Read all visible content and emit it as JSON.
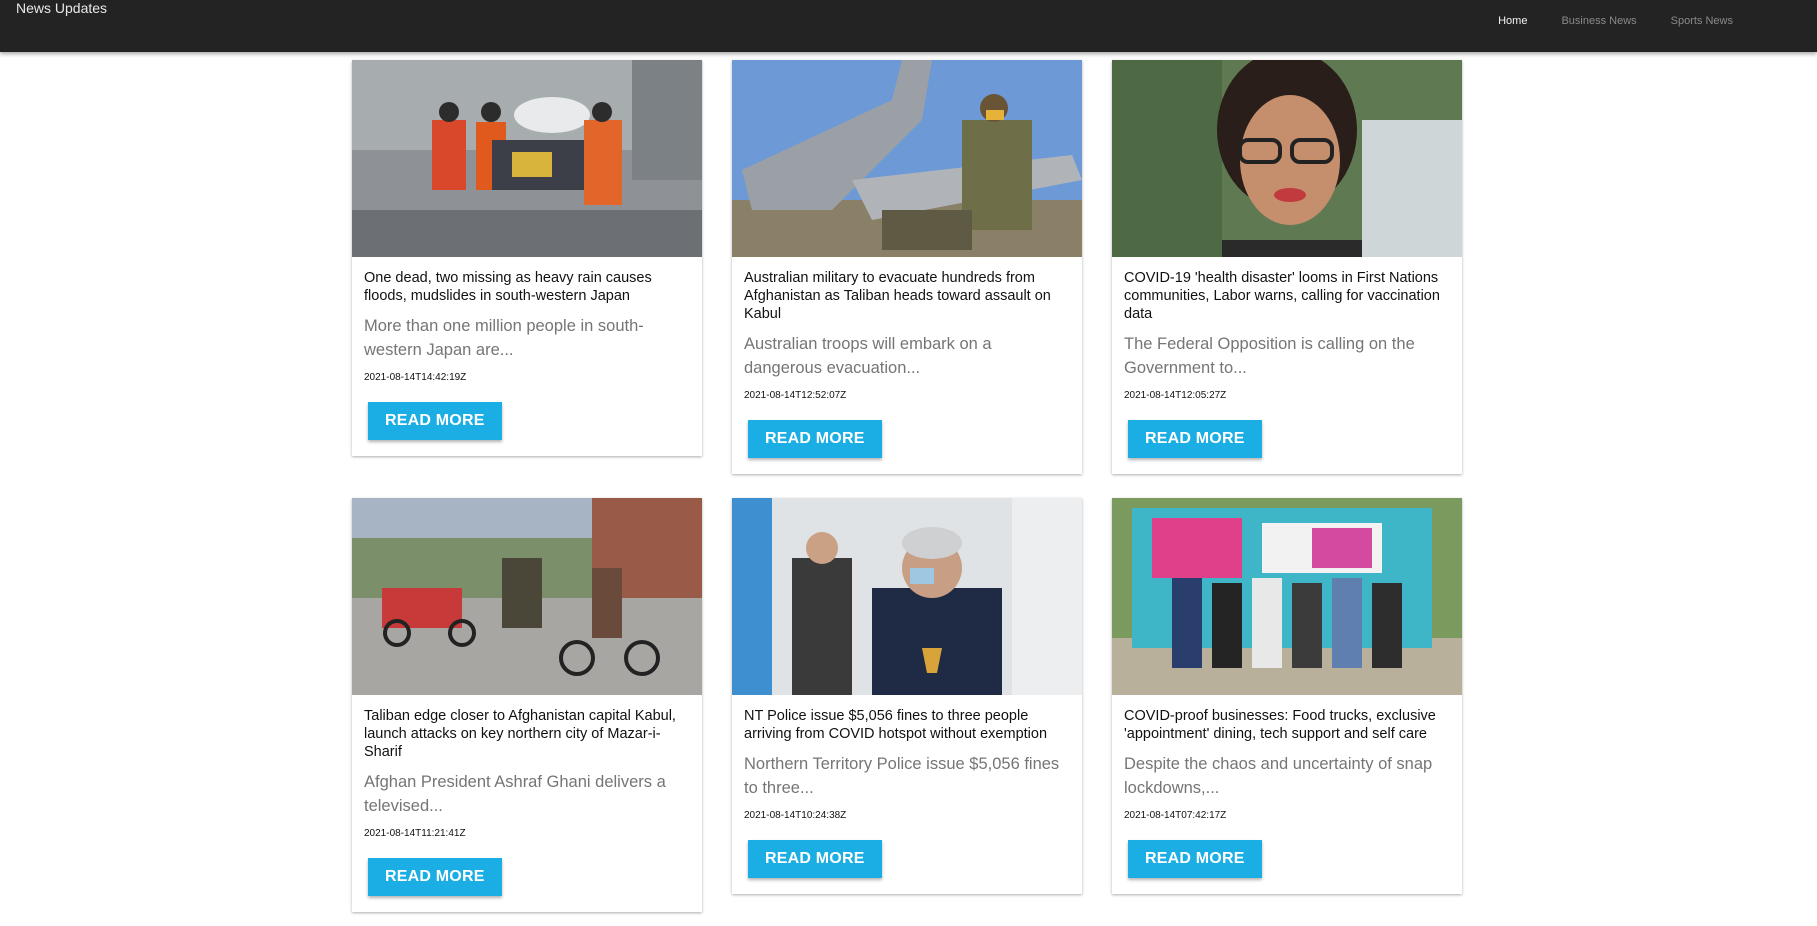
{
  "nav": {
    "brand": "News Updates",
    "links": [
      "Home",
      "Business News",
      "Sports News"
    ]
  },
  "articles": [
    {
      "title": "One dead, two missing as heavy rain causes floods, mudslides in south-western Japan",
      "description": "More than one million people in south-western Japan are...",
      "date": "2021-08-14T14:42:19Z",
      "button": "READ MORE"
    },
    {
      "title": "Australian military to evacuate hundreds from Afghanistan as Taliban heads toward assault on Kabul",
      "description": "Australian troops will embark on a dangerous evacuation...",
      "date": "2021-08-14T12:52:07Z",
      "button": "READ MORE"
    },
    {
      "title": "COVID-19 'health disaster' looms in First Nations communities, Labor warns, calling for vaccination data",
      "description": "The Federal Opposition is calling on the Government to...",
      "date": "2021-08-14T12:05:27Z",
      "button": "READ MORE"
    },
    {
      "title": "Taliban edge closer to Afghanistan capital Kabul, launch attacks on key northern city of Mazar-i-Sharif",
      "description": "Afghan President Ashraf Ghani delivers a televised...",
      "date": "2021-08-14T11:21:41Z",
      "button": "READ MORE"
    },
    {
      "title": "NT Police issue $5,056 fines to three people arriving from COVID hotspot without exemption",
      "description": "Northern Territory Police issue $5,056 fines to three...",
      "date": "2021-08-14T10:24:38Z",
      "button": "READ MORE"
    },
    {
      "title": "COVID-proof businesses: Food trucks, exclusive 'appointment' dining, tech support and self care",
      "description": "Despite the chaos and uncertainty of snap lockdowns,...",
      "date": "2021-08-14T07:42:17Z",
      "button": "READ MORE"
    }
  ]
}
